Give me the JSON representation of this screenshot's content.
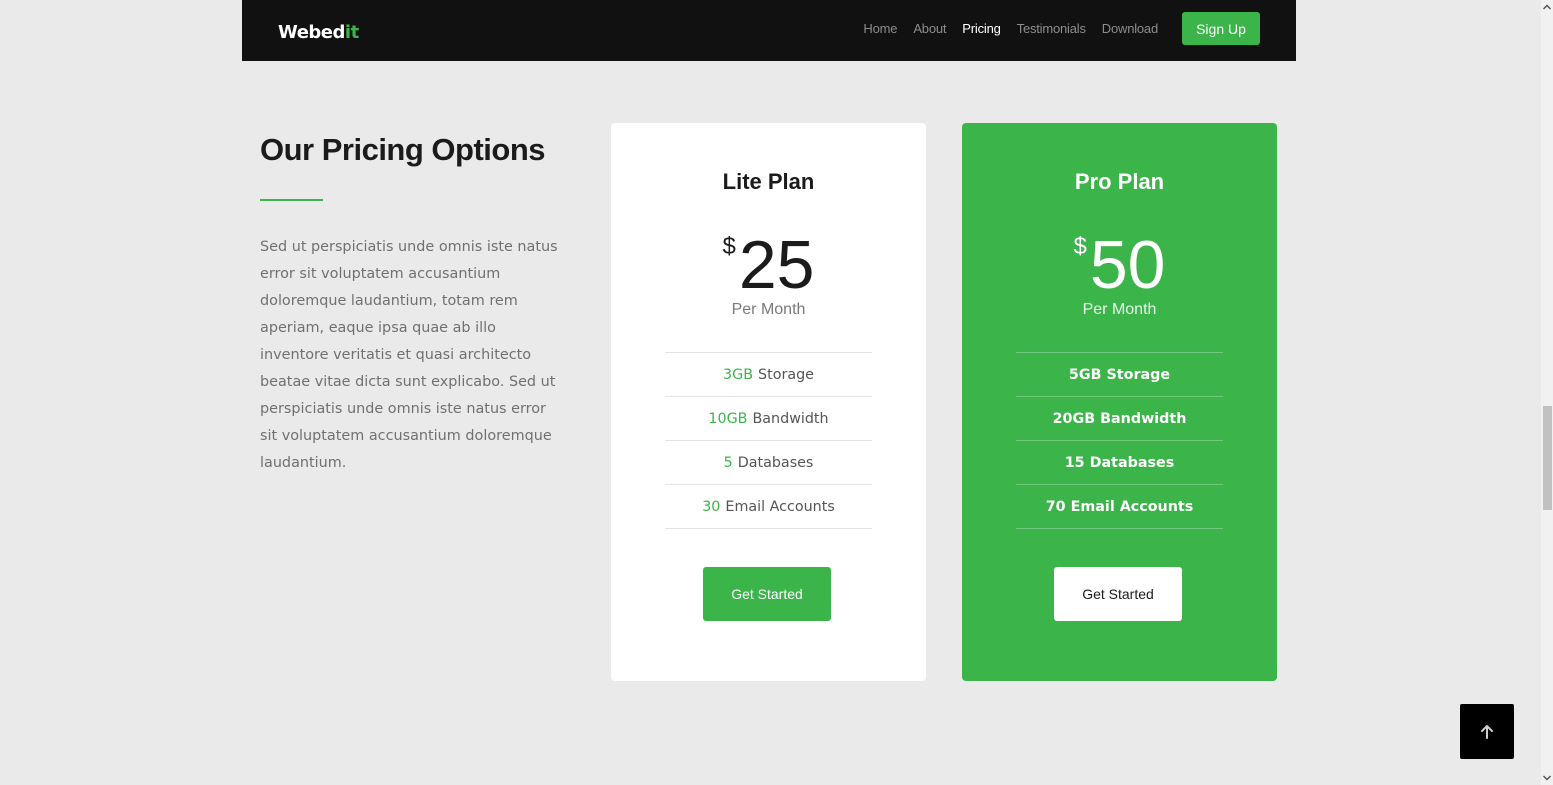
{
  "navbar": {
    "brand_main": "Webed",
    "brand_accent": "it",
    "links": [
      "Home",
      "About",
      "Pricing",
      "Testimonials",
      "Download"
    ],
    "active_link": "Pricing",
    "signup_label": "Sign Up"
  },
  "section": {
    "title": "Our Pricing Options",
    "description": "Sed ut perspiciatis unde omnis iste natus error sit voluptatem accusantium doloremque laudantium, totam rem aperiam, eaque ipsa quae ab illo inventore veritatis et quasi architecto beatae vitae dicta sunt explicabo. Sed ut perspiciatis unde omnis iste natus error sit voluptatem accusantium doloremque laudantium."
  },
  "plans": [
    {
      "name": "Lite Plan",
      "currency": "$",
      "price": "25",
      "period": "Per Month",
      "features": [
        {
          "num": "3GB",
          "label": "Storage"
        },
        {
          "num": "10GB",
          "label": "Bandwidth"
        },
        {
          "num": "5",
          "label": "Databases"
        },
        {
          "num": "30",
          "label": "Email Accounts"
        }
      ],
      "cta": "Get Started"
    },
    {
      "name": "Pro Plan",
      "currency": "$",
      "price": "50",
      "period": "Per Month",
      "features": [
        {
          "num": "5GB",
          "label": "Storage"
        },
        {
          "num": "20GB",
          "label": "Bandwidth"
        },
        {
          "num": "15",
          "label": "Databases"
        },
        {
          "num": "70",
          "label": "Email Accounts"
        }
      ],
      "cta": "Get Started"
    }
  ],
  "icons": {
    "back_to_top": "arrow-up-icon"
  },
  "colors": {
    "accent": "#3bb54a",
    "navbar": "#111111",
    "background": "#eaeaea"
  }
}
